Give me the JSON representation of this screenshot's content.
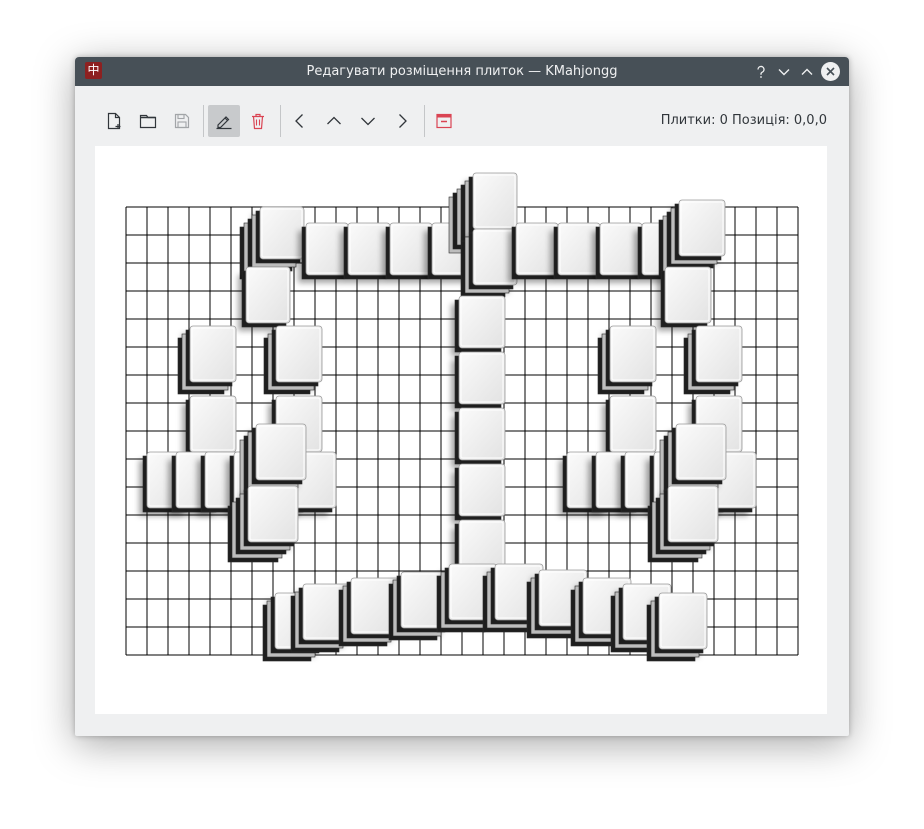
{
  "window": {
    "title": "Редагувати розміщення плиток — KMahjongg",
    "buttons": [
      "help",
      "minimize",
      "maximize",
      "close"
    ]
  },
  "toolbar": {
    "items": [
      {
        "name": "new-layout-button",
        "icon": "new-document-icon"
      },
      {
        "name": "open-layout-button",
        "icon": "folder-icon"
      },
      {
        "name": "save-layout-button",
        "icon": "save-icon",
        "disabled": true
      },
      {
        "name": "add-tile-button",
        "icon": "pencil-icon",
        "active": true
      },
      {
        "name": "delete-tile-button",
        "icon": "trash-icon"
      },
      {
        "name": "shift-left-button",
        "icon": "chevron-left-icon"
      },
      {
        "name": "shift-up-button",
        "icon": "chevron-up-icon"
      },
      {
        "name": "shift-down-button",
        "icon": "chevron-down-icon"
      },
      {
        "name": "shift-right-button",
        "icon": "chevron-right-icon"
      },
      {
        "name": "close-editor-button",
        "icon": "window-close-icon"
      }
    ]
  },
  "status": {
    "text": "Плитки: 0 Позиція: 0,0,0",
    "tiles_label": "Плитки:",
    "tiles_count": 0,
    "position_label": "Позиція:",
    "position": "0,0,0"
  },
  "board": {
    "grid_columns": 32,
    "grid_rows": 16,
    "description_shape": "scales",
    "tile_color": "#eeeeee"
  }
}
